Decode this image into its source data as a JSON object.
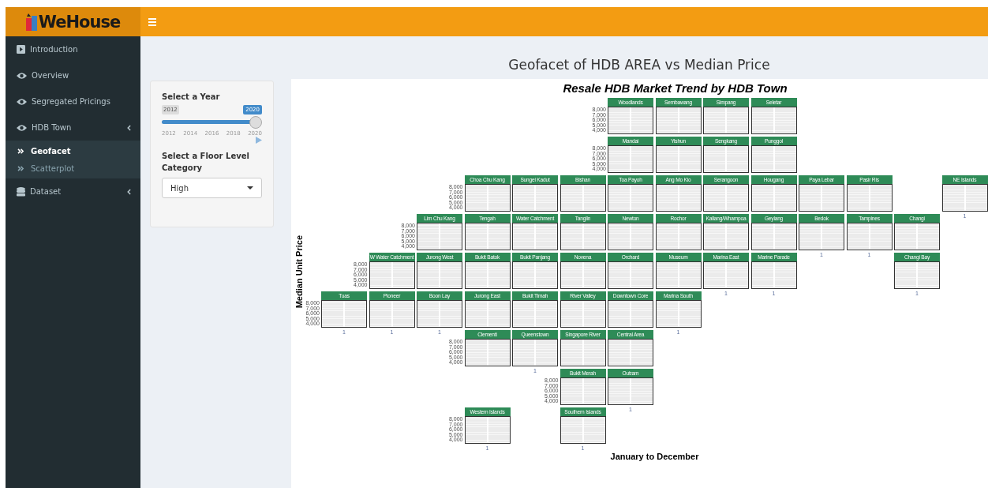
{
  "app": {
    "logo": "WeHouse"
  },
  "sidebar": {
    "items": [
      {
        "label": "Introduction",
        "expandable": false
      },
      {
        "label": "Overview",
        "expandable": false
      },
      {
        "label": "Segregated Pricings",
        "expandable": false
      },
      {
        "label": "HDB Town",
        "expandable": true,
        "children": [
          {
            "label": "Geofacet",
            "selected": true
          },
          {
            "label": "Scatterplot",
            "selected": false
          }
        ]
      },
      {
        "label": "Dataset",
        "expandable": true
      }
    ]
  },
  "page_title": "Geofacet of HDB AREA vs Median Price",
  "controls": {
    "year": {
      "label": "Select a Year",
      "min_label": "2012",
      "value_label": "2020",
      "level": 1,
      "ticks": [
        "2012",
        "2014",
        "2016",
        "2018",
        "2020"
      ]
    },
    "floor": {
      "label": "Select a Floor Level Category",
      "value": "High"
    }
  },
  "chart": {
    "title": "Resale HDB Market Trend by HDB Town",
    "ylabel": "Median Unit Price",
    "xlabel": "January to December",
    "rows": [
      [
        null,
        null,
        null,
        null,
        null,
        null,
        {
          "name": "Woodlands",
          "yticks": [
            "8,000",
            "7,000",
            "6,000",
            "5,000",
            "4,000"
          ]
        },
        {
          "name": "Sembawang"
        },
        {
          "name": "Simpang"
        },
        {
          "name": "Seletar"
        }
      ],
      [
        null,
        null,
        null,
        null,
        null,
        null,
        {
          "name": "Mandai",
          "yticks": [
            "8,000",
            "7,000",
            "6,000",
            "5,000",
            "4,000"
          ]
        },
        {
          "name": "Yishun"
        },
        {
          "name": "Sengkang"
        },
        {
          "name": "Punggol"
        }
      ],
      [
        null,
        null,
        null,
        {
          "name": "Choa Chu Kang",
          "yticks": [
            "8,000",
            "7,000",
            "6,000",
            "5,000",
            "4,000"
          ]
        },
        {
          "name": "Sungei Kadut"
        },
        {
          "name": "Bishan"
        },
        {
          "name": "Toa Payoh"
        },
        {
          "name": "Ang Mo Kio"
        },
        {
          "name": "Serangoon"
        },
        {
          "name": "Hougang"
        },
        {
          "name": "Paya Lebar"
        },
        {
          "name": "Pasir Ris"
        },
        null,
        {
          "name": "NE Islands",
          "xtick": "1"
        }
      ],
      [
        null,
        null,
        {
          "name": "Lim Chu Kang",
          "yticks": [
            "8,000",
            "7,000",
            "6,000",
            "5,000",
            "4,000"
          ]
        },
        {
          "name": "Tengah"
        },
        {
          "name": "Water Catchment"
        },
        {
          "name": "Tanglin"
        },
        {
          "name": "Newton"
        },
        {
          "name": "Rochor"
        },
        {
          "name": "Kallang/Whampoa"
        },
        {
          "name": "Geylang"
        },
        {
          "name": "Bedok",
          "xtick": "1"
        },
        {
          "name": "Tampines",
          "xtick": "1"
        },
        {
          "name": "Changi"
        }
      ],
      [
        null,
        {
          "name": "W Water Catchment",
          "yticks": [
            "8,000",
            "7,000",
            "6,000",
            "5,000",
            "4,000"
          ]
        },
        {
          "name": "Jurong West"
        },
        {
          "name": "Bukit Batok"
        },
        {
          "name": "Bukit Panjang"
        },
        {
          "name": "Novena"
        },
        {
          "name": "Orchard"
        },
        {
          "name": "Museum"
        },
        {
          "name": "Marina East",
          "xtick": "1"
        },
        {
          "name": "Marine Parade",
          "xtick": "1"
        },
        null,
        null,
        {
          "name": "Changi Bay",
          "xtick": "1"
        }
      ],
      [
        {
          "name": "Tuas",
          "yticks": [
            "8,000",
            "7,000",
            "6,000",
            "5,000",
            "4,000"
          ],
          "xtick": "1"
        },
        {
          "name": "Pioneer",
          "xtick": "1"
        },
        {
          "name": "Boon Lay",
          "xtick": "1"
        },
        {
          "name": "Jurong East"
        },
        {
          "name": "Bukit Timah"
        },
        {
          "name": "River Valley"
        },
        {
          "name": "Downtown Core"
        },
        {
          "name": "Marina South",
          "xtick": "1"
        }
      ],
      [
        null,
        null,
        null,
        {
          "name": "Clementi",
          "yticks": [
            "8,000",
            "7,000",
            "6,000",
            "5,000",
            "4,000"
          ]
        },
        {
          "name": "Queenstown",
          "xtick": "1"
        },
        {
          "name": "Singapore River"
        },
        {
          "name": "Central Area"
        }
      ],
      [
        null,
        null,
        null,
        null,
        null,
        {
          "name": "Bukit Merah",
          "yticks": [
            "8,000",
            "7,000",
            "6,000",
            "5,000",
            "4,000"
          ]
        },
        {
          "name": "Outram",
          "xtick": "1"
        }
      ],
      [
        null,
        null,
        null,
        {
          "name": "Western Islands",
          "yticks": [
            "8,000",
            "7,000",
            "6,000",
            "5,000",
            "4,000"
          ],
          "xtick": "1"
        },
        null,
        {
          "name": "Southern Islands",
          "xtick": "1"
        }
      ]
    ]
  }
}
